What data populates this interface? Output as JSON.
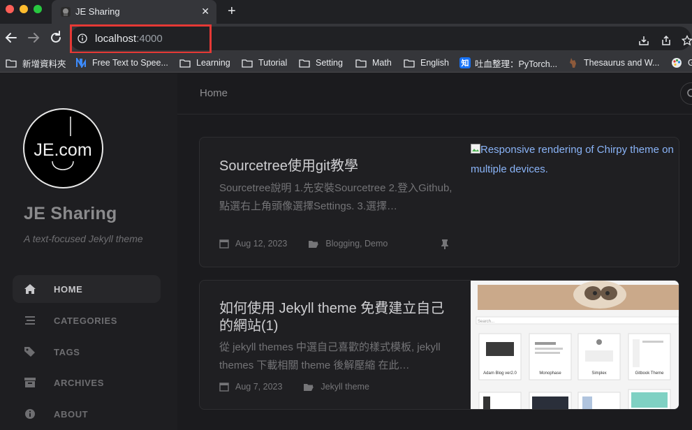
{
  "browser": {
    "tab_title": "JE Sharing",
    "url_host": "localhost",
    "url_port": ":4000"
  },
  "bookmarks": [
    {
      "label": "新增資料夾",
      "icon": "folder-icon"
    },
    {
      "label": "Free Text to Spee...",
      "icon": "n-logo-icon"
    },
    {
      "label": "Learning",
      "icon": "folder-icon"
    },
    {
      "label": "Tutorial",
      "icon": "folder-icon"
    },
    {
      "label": "Setting",
      "icon": "folder-icon"
    },
    {
      "label": "Math",
      "icon": "folder-icon"
    },
    {
      "label": "English",
      "icon": "folder-icon"
    },
    {
      "label": "吐血整理：PyTorch...",
      "icon": "zhihu-icon",
      "badge": "知"
    },
    {
      "label": "Thesaurus and W...",
      "icon": "deer-icon"
    },
    {
      "label": "G",
      "icon": "palette-icon"
    }
  ],
  "sidebar": {
    "avatar_text": "JE.com",
    "title": "JE Sharing",
    "subtitle": "A text-focused Jekyll theme",
    "nav": [
      {
        "label": "HOME",
        "icon": "home-icon",
        "active": true
      },
      {
        "label": "CATEGORIES",
        "icon": "stream-icon",
        "active": false
      },
      {
        "label": "TAGS",
        "icon": "tag-icon",
        "active": false
      },
      {
        "label": "ARCHIVES",
        "icon": "archive-icon",
        "active": false
      },
      {
        "label": "ABOUT",
        "icon": "info-icon",
        "active": false
      }
    ]
  },
  "main": {
    "breadcrumb": "Home",
    "posts": [
      {
        "title": "Sourcetree使用git教學",
        "excerpt": "Sourcetree說明 1.先安裝Sourcetree 2.登入Github,點選右上角頭像選擇Settings. 3.選擇…",
        "date": "Aug 12, 2023",
        "categories": "Blogging, Demo",
        "pinned": true,
        "image_alt": "Responsive rendering of Chirpy theme on multiple devices."
      },
      {
        "title": "如何使用 Jekyll theme 免費建立自己的網站(1)",
        "excerpt": "從 jekyll themes 中選自己喜歡的樣式模板, jekyll themes 下載相關 theme 後解壓縮 在此…",
        "date": "Aug 7, 2023",
        "categories": "Jekyll theme",
        "pinned": false,
        "thumb_search": "Search...",
        "thumbs": [
          "Adam Blog ver2.0",
          "Monophase",
          "Simplex",
          "Gitbook Theme"
        ]
      }
    ]
  },
  "colors": {
    "accent_red": "#e53935",
    "link_blue": "#8ab4f8",
    "sidebar_bg": "#1e1e21",
    "page_bg": "#1b1b1e"
  }
}
